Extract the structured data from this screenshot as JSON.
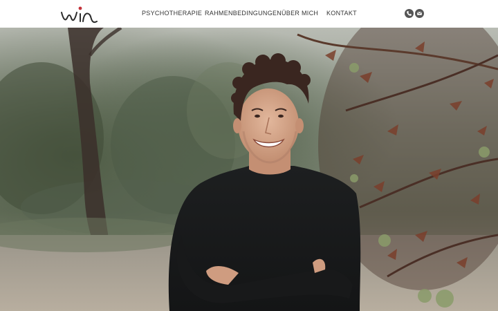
{
  "header": {
    "logo_text": "win",
    "nav": [
      {
        "label": "PSYCHOTHERAPIE"
      },
      {
        "label": "RAHMENBEDINGUNGEN"
      },
      {
        "label": "ÜBER MICH"
      },
      {
        "label": "KONTAKT"
      }
    ],
    "icons": {
      "phone": "phone-icon",
      "mail": "mail-icon"
    }
  },
  "hero": {
    "image": "portrait-photo"
  },
  "colors": {
    "text": "#333333",
    "icon_bg": "#555555",
    "logo_dark": "#2b2b2b",
    "logo_accent": "#c4323a"
  }
}
